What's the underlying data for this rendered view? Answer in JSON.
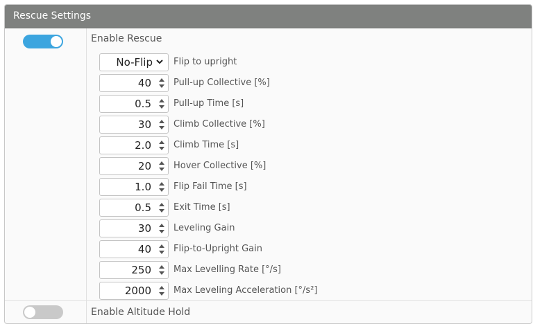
{
  "panel": {
    "title": "Rescue Settings"
  },
  "rescue": {
    "enable_label": "Enable Rescue",
    "enabled": true,
    "flip": {
      "value": "No-Flip",
      "label": "Flip to upright"
    },
    "settings": [
      {
        "value": "40",
        "label": "Pull-up Collective [%]"
      },
      {
        "value": "0.5",
        "label": "Pull-up Time [s]"
      },
      {
        "value": "30",
        "label": "Climb Collective [%]"
      },
      {
        "value": "2.0",
        "label": "Climb Time [s]"
      },
      {
        "value": "20",
        "label": "Hover Collective [%]"
      },
      {
        "value": "1.0",
        "label": "Flip Fail Time [s]"
      },
      {
        "value": "0.5",
        "label": "Exit Time [s]"
      },
      {
        "value": "30",
        "label": "Leveling Gain"
      },
      {
        "value": "40",
        "label": "Flip-to-Upright Gain"
      },
      {
        "value": "250",
        "label": "Max Levelling Rate [°/s]"
      },
      {
        "value": "2000",
        "label": "Max Leveling Acceleration [°/s²]"
      }
    ],
    "help_glyph": "?"
  },
  "altitude_hold": {
    "label": "Enable Altitude Hold",
    "enabled": false
  },
  "colors": {
    "header": "#7f817f",
    "toggle_on": "#3ca5df",
    "toggle_off": "#c9c9c9"
  }
}
